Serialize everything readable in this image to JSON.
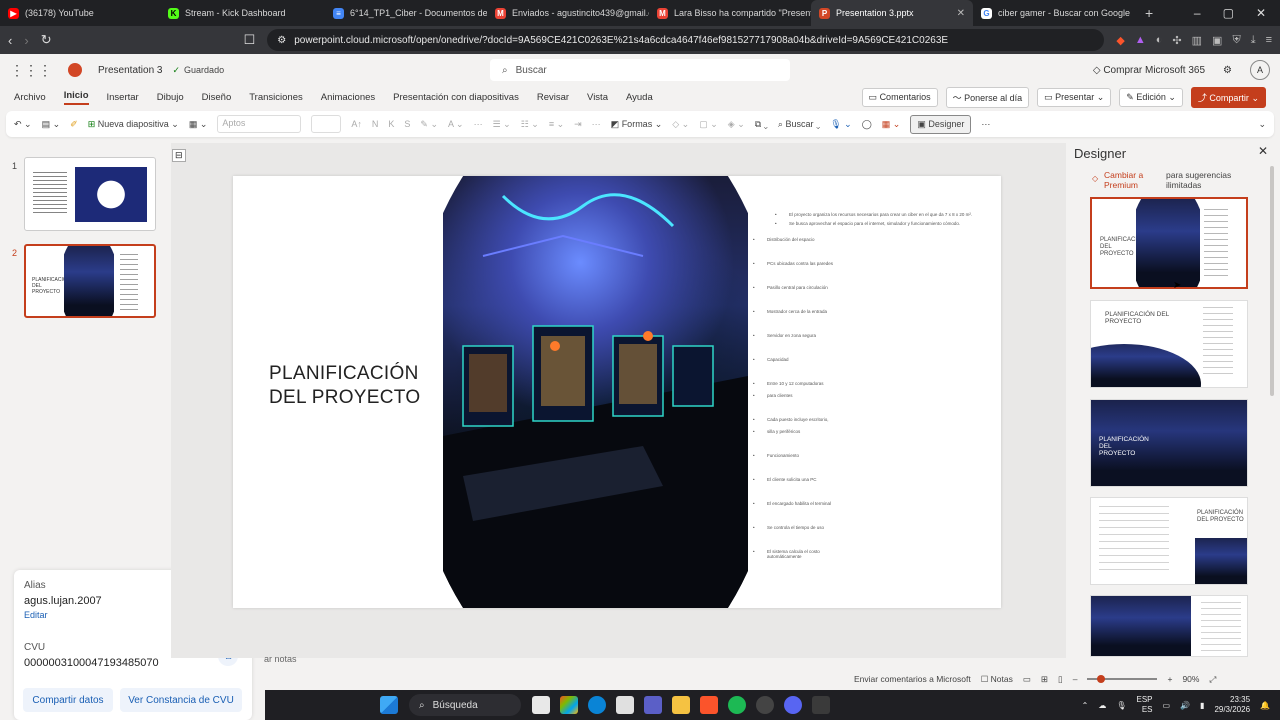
{
  "browser": {
    "tabs": [
      {
        "label": "(36178) YouTube",
        "color": "#ff0000",
        "glyph": "▶"
      },
      {
        "label": "Stream - Kick Dashboard",
        "color": "#53fc18",
        "glyph": "K"
      },
      {
        "label": "6°14_TP1_Ciber - Documentos de G",
        "color": "#4285f4",
        "glyph": "≡"
      },
      {
        "label": "Enviados - agustincito439@gmail.co",
        "color": "#ea4335",
        "glyph": "M"
      },
      {
        "label": "Lara Bisso ha compartido \"Presentati",
        "color": "#ea4335",
        "glyph": "M"
      },
      {
        "label": "Presentation 3.pptx",
        "color": "#d24726",
        "glyph": "P",
        "active": true
      },
      {
        "label": "ciber gamer - Buscar con Google",
        "color": "#ffffff",
        "glyph": "G"
      }
    ],
    "new_tab": "+",
    "url": "powerpoint.cloud.microsoft/open/onedrive/?docId=9A569CE421C0263E%21s4a6cdca4647f46ef981527717908a04b&driveId=9A569CE421C0263E"
  },
  "office": {
    "doc_title": "Presentation 3",
    "saved_status": "Guardado",
    "search_placeholder": "Buscar",
    "buy_label": "Comprar Microsoft 365",
    "avatar_initial": "A"
  },
  "ribbon": {
    "tabs": [
      "Archivo",
      "Inicio",
      "Insertar",
      "Dibujo",
      "Diseño",
      "Transiciones",
      "Animaciones",
      "Presentación con diapositivas",
      "Revisar",
      "Vista",
      "Ayuda"
    ],
    "active_tab": "Inicio",
    "comments": "Comentarios",
    "catch_up": "Ponerse al día",
    "present": "Presentar",
    "edit_mode": "Edición",
    "share": "Compartir"
  },
  "toolbar": {
    "new_slide": "Nueva diapositiva",
    "font": "Aptos",
    "font_size": "",
    "shapes": "Formas",
    "find": "Buscar",
    "designer": "Designer"
  },
  "thumbnails": {
    "slide1_number": "1",
    "slide2_number": "2",
    "slide2_title": "PLANIFICACIÓN DEL PROYECTO"
  },
  "alias_panel": {
    "alias_label": "Alias",
    "alias_value": "agus.lujan.2007",
    "edit_link": "Editar",
    "cvu_label": "CVU",
    "cvu_value": "0000003100047193485070",
    "share_button": "Compartir datos",
    "certificate_button": "Ver Constancia de CVU"
  },
  "slide": {
    "title_line1": "PLANIFICACIÓN",
    "title_line2": "DEL PROYECTO",
    "bullets": [
      "El proyecto organiza los recursos necesarios para crear un ciber en el que da 7 x 8 x 20 m².",
      "Se busca aprovechar el espacio para el internet, simulador y funcionamiento cómodo.",
      "Distribución del espacio",
      "PCs ubicadas contra las paredes",
      "Pasillo central para circulación",
      "Mostrador cerca de la entrada",
      "Servidor en zona segura",
      "Capacidad",
      "Entre 10 y 12 computadoras",
      "para clientes",
      "Cada puesto incluye escritorio,",
      "silla y periféricos",
      "Funcionamiento",
      "El cliente solicita una PC",
      "El encargado habilita el terminal",
      "Se controla el tiempo de uso",
      "El sistema calcula el costo automáticamente"
    ]
  },
  "notes_label": "ar notas",
  "designer": {
    "title": "Designer",
    "premium_line1": "Cambiar a",
    "premium_line2": "Premium",
    "premium_desc1": "para sugerencias",
    "premium_desc2": "ilimitadas",
    "option_title": "PLANIFICACIÓN DEL PROYECTO"
  },
  "statusbar": {
    "feedback": "Enviar comentarios a Microsoft",
    "notes": "Notas",
    "zoom": "90%"
  },
  "taskbar": {
    "search": "Búsqueda",
    "lang1": "ESP",
    "lang2": "ES",
    "time": "23:35",
    "date": "29/3/2026"
  }
}
